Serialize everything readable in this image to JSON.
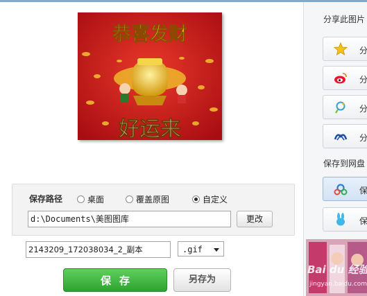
{
  "preview": {
    "top_text": "恭喜发财",
    "bottom_text": "好运来"
  },
  "save_path": {
    "label": "保存路径",
    "options": [
      {
        "label": "桌面",
        "selected": false
      },
      {
        "label": "覆盖原图",
        "selected": false
      },
      {
        "label": "自定义",
        "selected": true
      }
    ],
    "path_value": "d:\\Documents\\美图图库",
    "change_button": "更改"
  },
  "file": {
    "name_value": "2143209_172038034_2_副本",
    "format_value": ".gif"
  },
  "actions": {
    "save_label": "保存",
    "save_as_label": "另存为"
  },
  "sidebar": {
    "share_title": "分享此图片",
    "share_items": [
      {
        "icon": "star-icon",
        "label": "分"
      },
      {
        "icon": "weibo-icon",
        "label": "分"
      },
      {
        "icon": "qzone-icon",
        "label": "分"
      },
      {
        "icon": "renren-icon",
        "label": "分"
      }
    ],
    "save_to_title": "保存到网盘",
    "save_items": [
      {
        "icon": "cloud-icon",
        "label": "保"
      },
      {
        "icon": "bunny-icon",
        "label": "保"
      }
    ]
  },
  "watermark": {
    "text": "Bai du 经验",
    "sub": "jingyan.baidu.com"
  },
  "colors": {
    "save_green": "#3bb43c",
    "accent_blue": "#7fa9cf",
    "preview_red": "#c4161c"
  }
}
